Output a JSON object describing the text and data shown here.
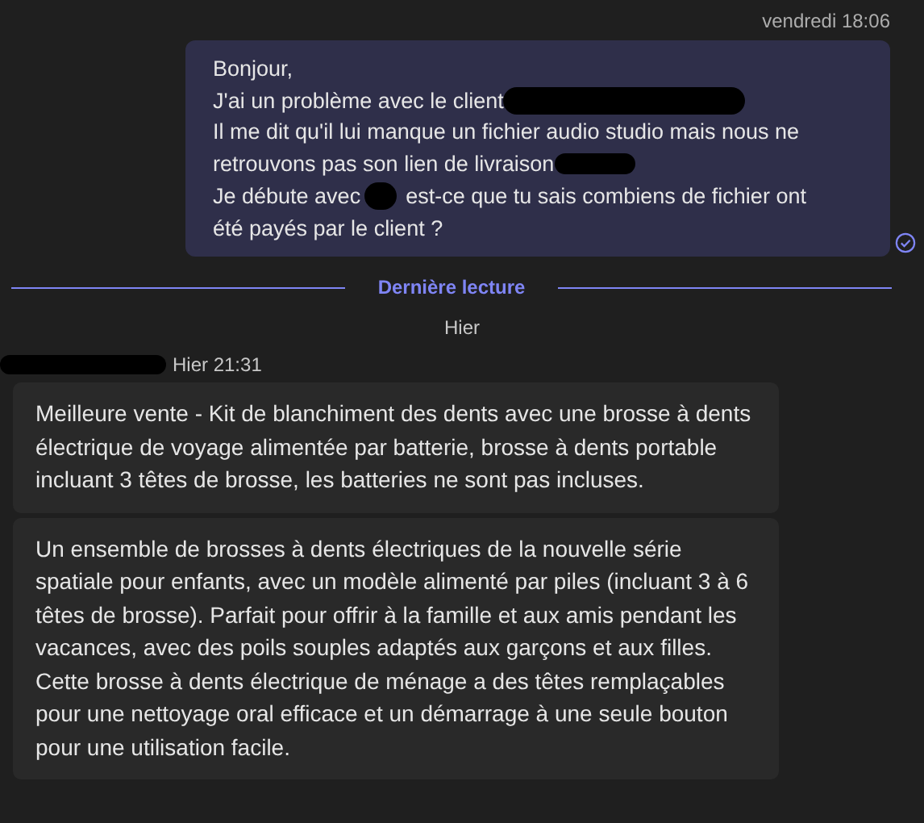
{
  "sent_message": {
    "timestamp": "vendredi 18:06",
    "read": true,
    "lines": [
      [
        {
          "kind": "text",
          "text": "Bonjour,"
        }
      ],
      [
        {
          "kind": "text",
          "text": "J'ai un problème avec le client"
        },
        {
          "kind": "redaction-long"
        }
      ],
      [
        {
          "kind": "text",
          "text": "Il me dit qu'il lui manque un fichier audio studio mais nous ne"
        }
      ],
      [
        {
          "kind": "text",
          "text": "retrouvons pas son lien de livraison"
        },
        {
          "kind": "redaction-short"
        }
      ],
      [
        {
          "kind": "text",
          "text": "Je débute avec"
        },
        {
          "kind": "redaction-dot"
        },
        {
          "kind": "text",
          "text": "est-ce que tu sais combiens de fichier ont"
        }
      ],
      [
        {
          "kind": "text",
          "text": "été payés par le client ?"
        }
      ]
    ]
  },
  "read_divider": {
    "label": "Dernière lecture"
  },
  "day_label": "Hier",
  "received": {
    "sender_redacted": true,
    "timestamp": "Hier 21:31",
    "messages": [
      "Meilleure vente - Kit de blanchiment des dents avec une brosse à dents électrique de voyage alimentée par batterie, brosse à dents portable incluant 3 têtes de brosse, les batteries ne sont pas incluses.",
      "Un ensemble de brosses à dents électriques de la nouvelle série spatiale pour enfants, avec un modèle alimenté par piles (incluant 3 à 6 têtes de brosse). Parfait pour offrir à la famille et aux amis pendant les vacances, avec des poils souples adaptés aux garçons et aux filles. Cette brosse à dents électrique de ménage a des têtes remplaçables pour une nettoyage oral efficace et un démarrage à une seule bouton pour une utilisation facile."
    ]
  }
}
